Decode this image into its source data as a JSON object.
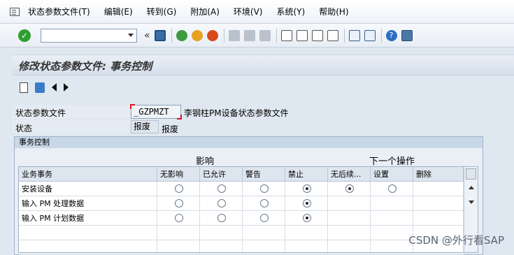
{
  "menubar": {
    "items": [
      "状态参数文件(T)",
      "编辑(E)",
      "转到(G)",
      "附加(A)",
      "环境(V)",
      "系统(Y)",
      "帮助(H)"
    ]
  },
  "toolbar": {
    "command_value": "",
    "dbl_arrow": "«",
    "icons": [
      "enter-icon",
      "save-icon",
      "back-icon",
      "exit-icon",
      "cancel-icon",
      "print-icon",
      "find-icon",
      "find-next-icon",
      "first-page-icon",
      "prev-page-icon",
      "next-page-icon",
      "last-page-icon",
      "new-session-icon",
      "shortcut-icon",
      "help-icon",
      "layout-icon"
    ]
  },
  "title": "修改状态参数文件: 事务控制",
  "form": {
    "profile_label": "状态参数文件",
    "profile_value": "_GZPMZT",
    "profile_desc": "李钢柱PM设备状态参数文件",
    "status_label": "状态",
    "status_value": "报废",
    "status_desc": "报废"
  },
  "group": {
    "title": "事务控制",
    "influence_header": "影响",
    "next_op_header": "下一个操作"
  },
  "table": {
    "columns": [
      "业务事务",
      "无影响",
      "已允许",
      "警告",
      "禁止",
      "无后续...",
      "设置",
      "删除"
    ],
    "rows": [
      {
        "label": "安装设备",
        "selected": [
          3,
          4
        ]
      },
      {
        "label": "输入 PM 处理数据",
        "selected": [
          3
        ]
      },
      {
        "label": "输入 PM 计划数据",
        "selected": [
          3
        ]
      }
    ]
  },
  "watermark": "CSDN @外行看SAP"
}
